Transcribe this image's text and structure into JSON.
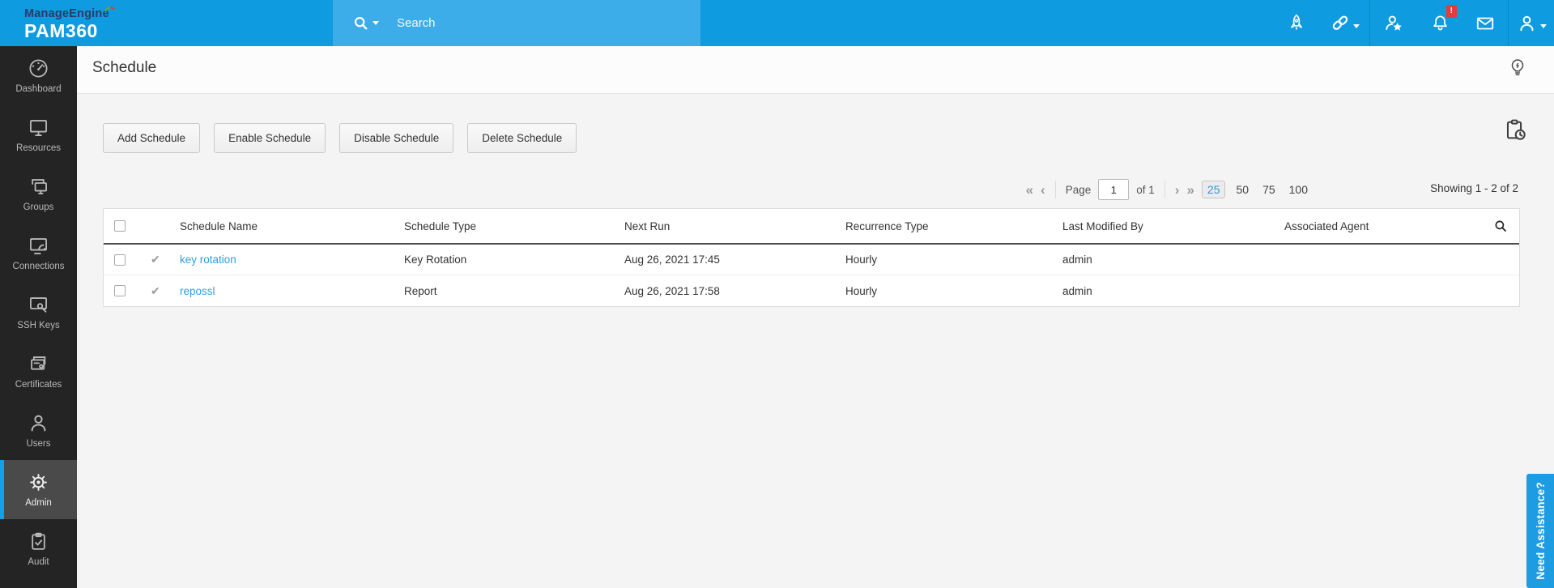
{
  "brand": {
    "company": "ManageEngine",
    "product": "PAM360"
  },
  "topbar": {
    "search_placeholder": "Search",
    "notification_badge": "!",
    "icons": [
      "rocket",
      "link",
      "user-star",
      "bell",
      "mail",
      "account"
    ]
  },
  "sidebar": {
    "items": [
      {
        "label": "Dashboard",
        "icon": "gauge",
        "active": false
      },
      {
        "label": "Resources",
        "icon": "monitor",
        "active": false
      },
      {
        "label": "Groups",
        "icon": "monitors",
        "active": false
      },
      {
        "label": "Connections",
        "icon": "monitor-dish",
        "active": false
      },
      {
        "label": "SSH Keys",
        "icon": "monitor-key",
        "active": false
      },
      {
        "label": "Certificates",
        "icon": "certificate-cards",
        "active": false
      },
      {
        "label": "Users",
        "icon": "person",
        "active": false
      },
      {
        "label": "Admin",
        "icon": "gear",
        "active": true
      },
      {
        "label": "Audit",
        "icon": "clipboard-check",
        "active": false
      }
    ]
  },
  "page": {
    "title": "Schedule"
  },
  "toolbar": {
    "buttons": [
      "Add Schedule",
      "Enable Schedule",
      "Disable Schedule",
      "Delete Schedule"
    ]
  },
  "pagination": {
    "first": "«",
    "prev": "‹",
    "page_label": "Page",
    "page_value": "1",
    "of_label": "of 1",
    "next": "›",
    "last": "»",
    "sizes": [
      "25",
      "50",
      "75",
      "100"
    ],
    "active_size": "25",
    "showing": "Showing 1 - 2 of 2"
  },
  "table": {
    "columns": [
      "Schedule Name",
      "Schedule Type",
      "Next Run",
      "Recurrence Type",
      "Last Modified By",
      "Associated Agent"
    ],
    "rows": [
      {
        "enabled": "✔",
        "name": "key rotation",
        "type": "Key Rotation",
        "next_run": "Aug 26, 2021 17:45",
        "recurrence": "Hourly",
        "modified_by": "admin",
        "agent": ""
      },
      {
        "enabled": "✔",
        "name": "repossl",
        "type": "Report",
        "next_run": "Aug 26, 2021 17:58",
        "recurrence": "Hourly",
        "modified_by": "admin",
        "agent": ""
      }
    ]
  },
  "assistance": {
    "label": "Need Assistance?"
  },
  "colors": {
    "topbar": "#0e9be0",
    "topbar_search": "#3cade8",
    "sidebar": "#242424",
    "active_accent": "#14a0e8",
    "link": "#2f9ee0",
    "badge_red": "#e23c3c",
    "header_underline": "#4f4f4f"
  }
}
